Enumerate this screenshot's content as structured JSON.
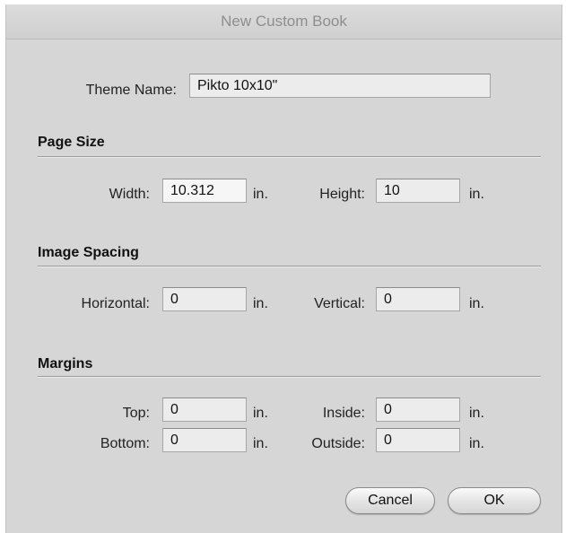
{
  "dialog": {
    "title": "New Custom Book"
  },
  "theme": {
    "label": "Theme Name:",
    "value": "Pikto 10x10\""
  },
  "page_size": {
    "title": "Page Size",
    "width_label": "Width:",
    "width_value": "10.312",
    "width_unit": "in.",
    "height_label": "Height:",
    "height_value": "10",
    "height_unit": "in."
  },
  "image_spacing": {
    "title": "Image Spacing",
    "horizontal_label": "Horizontal:",
    "horizontal_value": "0",
    "horizontal_unit": "in.",
    "vertical_label": "Vertical:",
    "vertical_value": "0",
    "vertical_unit": "in."
  },
  "margins": {
    "title": "Margins",
    "top_label": "Top:",
    "top_value": "0",
    "top_unit": "in.",
    "inside_label": "Inside:",
    "inside_value": "0",
    "inside_unit": "in.",
    "bottom_label": "Bottom:",
    "bottom_value": "0",
    "bottom_unit": "in.",
    "outside_label": "Outside:",
    "outside_value": "0",
    "outside_unit": "in."
  },
  "buttons": {
    "cancel": "Cancel",
    "ok": "OK"
  }
}
